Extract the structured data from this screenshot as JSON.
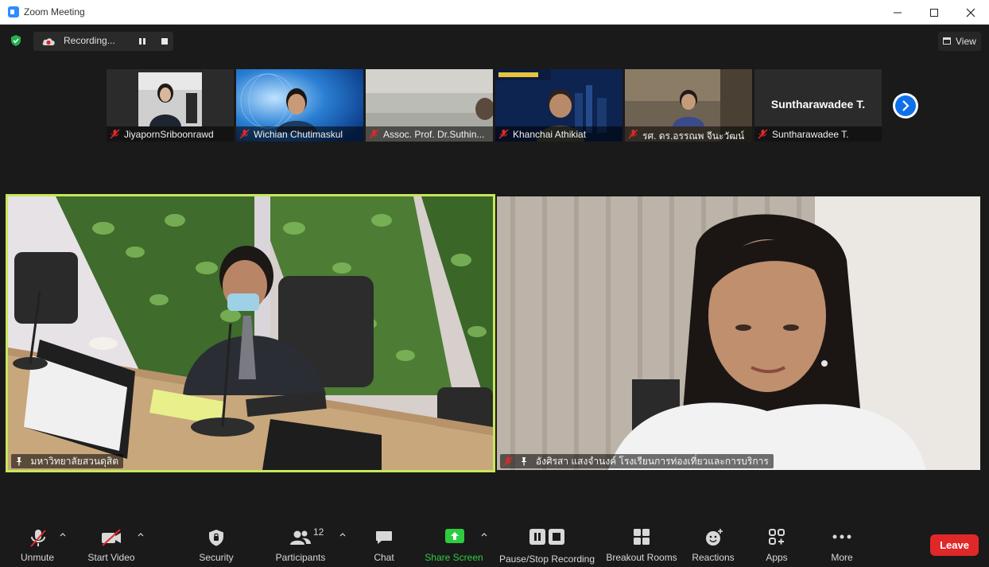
{
  "window": {
    "title": "Zoom Meeting",
    "controls": [
      "minimize",
      "maximize",
      "close"
    ]
  },
  "topbar": {
    "security_status_icon": "shield-check-icon",
    "recording_label": "Recording...",
    "view_label": "View"
  },
  "thumbnails": [
    {
      "name": "JiyapornSriboonrawd",
      "muted": true
    },
    {
      "name": "Wichian Chutimaskul",
      "muted": true
    },
    {
      "name": "Assoc. Prof. Dr.Suthin...",
      "muted": true
    },
    {
      "name": "Khanchai Athikiat",
      "muted": true
    },
    {
      "name": "รศ. ดร.อรรณพ จีนะวัฒน์",
      "muted": true
    },
    {
      "name": "Suntharawadee T.",
      "display_name": "Suntharawadee T.",
      "muted": true,
      "video_off": true
    }
  ],
  "gallery": {
    "tile1": {
      "name": "มหาวิทยาลัยสวนดุสิต",
      "active_speaker": true,
      "pinned": true
    },
    "tile2": {
      "name": "อังศิรสา แสงจำนงค์ โรงเรียนการท่องเที่ยวและการบริการ",
      "muted": true,
      "pinned": true
    }
  },
  "toolbar": {
    "unmute_label": "Unmute",
    "start_video_label": "Start Video",
    "security_label": "Security",
    "participants_label": "Participants",
    "participants_count": "12",
    "chat_label": "Chat",
    "share_screen_label": "Share Screen",
    "recording_label": "Pause/Stop Recording",
    "breakout_label": "Breakout Rooms",
    "reactions_label": "Reactions",
    "apps_label": "Apps",
    "more_label": "More",
    "leave_label": "Leave"
  },
  "colors": {
    "active_speaker_border": "#c7e75a",
    "share_screen_green": "#2ecc40",
    "leave_red": "#e02828",
    "accent_blue": "#0e71eb",
    "muted_red": "#e02828"
  }
}
